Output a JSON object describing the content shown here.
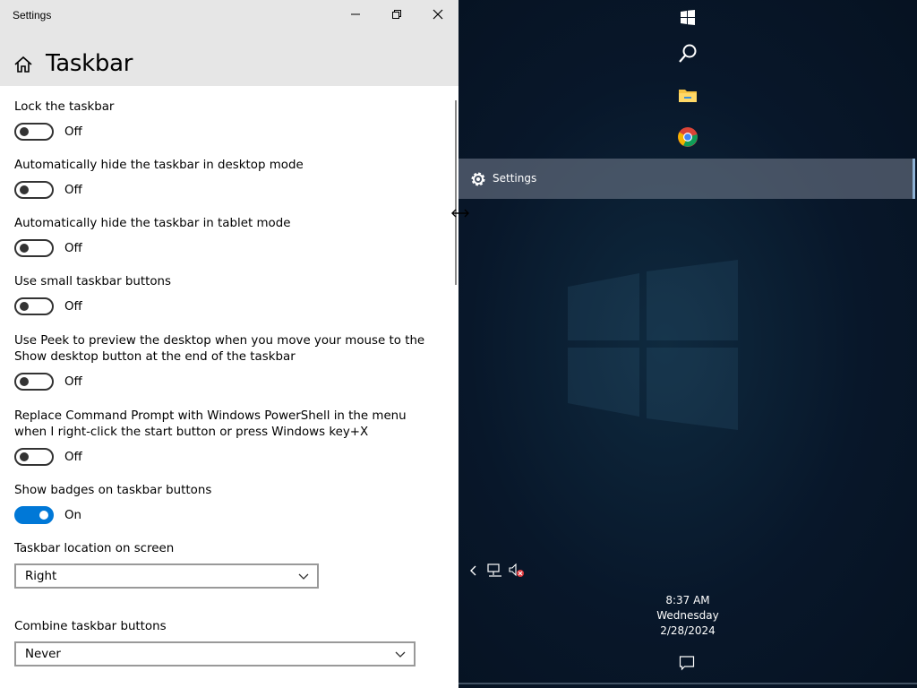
{
  "window": {
    "app_title": "Settings",
    "page_title": "Taskbar"
  },
  "settings": [
    {
      "label": "Lock the taskbar",
      "state": "Off",
      "on": false
    },
    {
      "label": "Automatically hide the taskbar in desktop mode",
      "state": "Off",
      "on": false
    },
    {
      "label": "Automatically hide the taskbar in tablet mode",
      "state": "Off",
      "on": false
    },
    {
      "label": "Use small taskbar buttons",
      "state": "Off",
      "on": false
    },
    {
      "label_line1": "Use Peek to preview the desktop when you move your mouse to the",
      "label_line2": "Show desktop button at the end of the taskbar",
      "state": "Off",
      "on": false
    },
    {
      "label_line1": "Replace Command Prompt with Windows PowerShell in the menu",
      "label_line2": "when I right-click the start button or press Windows key+X",
      "state": "Off",
      "on": false
    },
    {
      "label": "Show badges on taskbar buttons",
      "state": "On",
      "on": true
    }
  ],
  "location": {
    "label": "Taskbar location on screen",
    "value": "Right"
  },
  "combine": {
    "label": "Combine taskbar buttons",
    "value": "Never"
  },
  "taskbar": {
    "active_item": "Settings",
    "clock": {
      "time": "8:37 AM",
      "day": "Wednesday",
      "date": "2/28/2024"
    }
  },
  "colors": {
    "accent": "#0078d7",
    "titlebar": "#e6e6e6"
  }
}
